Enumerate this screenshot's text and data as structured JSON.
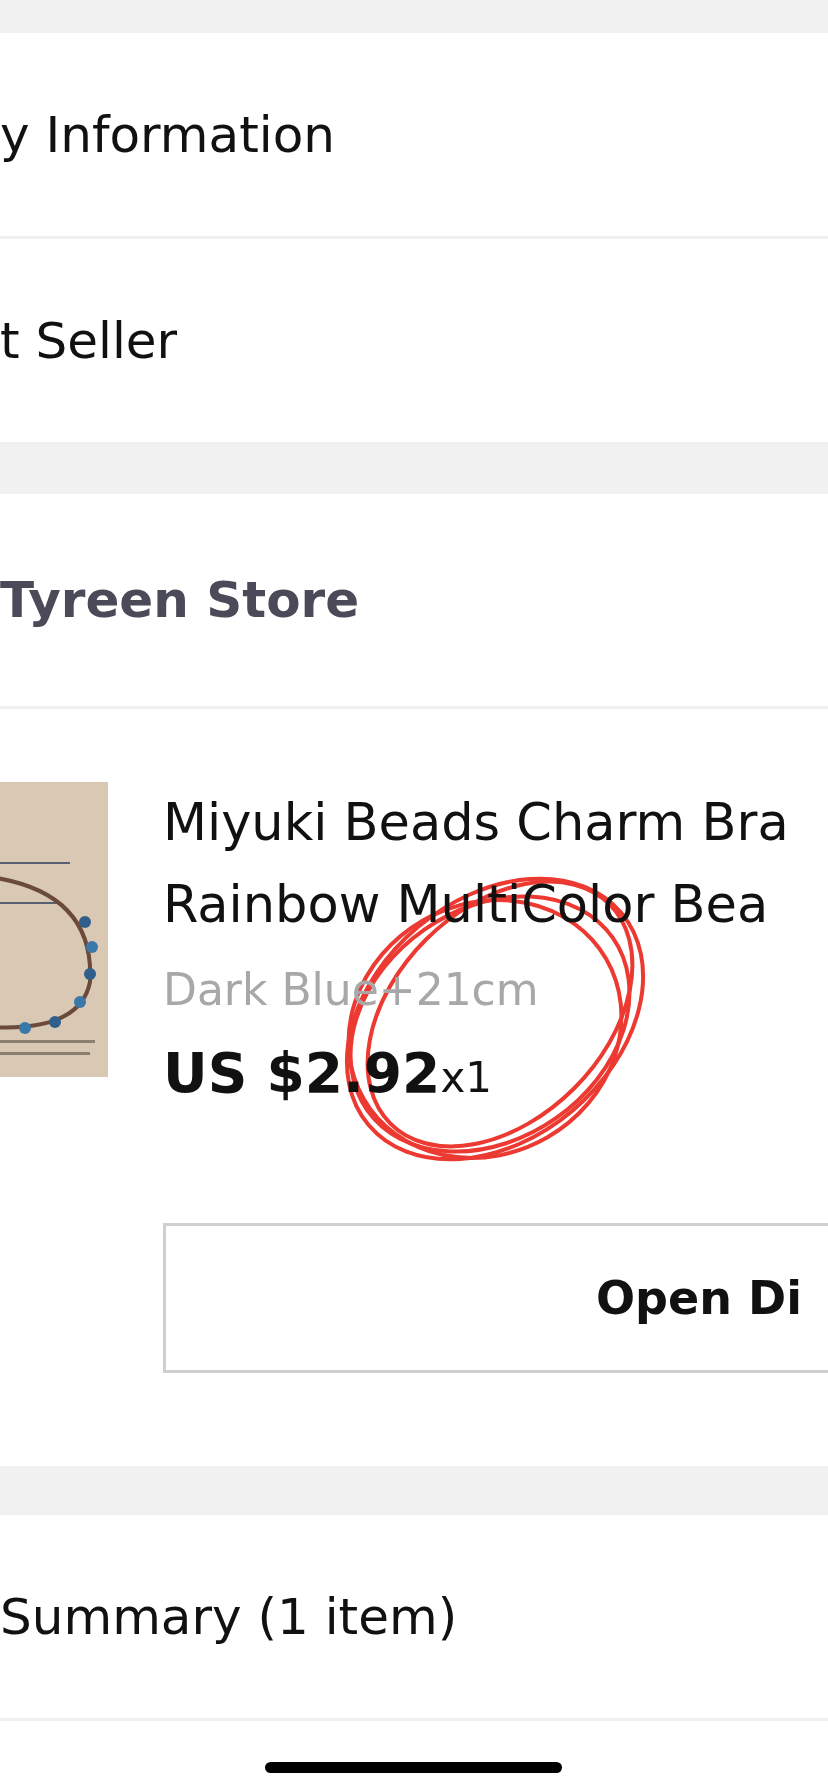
{
  "sections": [
    {
      "kind": "row",
      "label": "y Information"
    },
    {
      "kind": "row",
      "label": "t Seller"
    },
    {
      "kind": "gap"
    },
    {
      "kind": "store",
      "label": "Tyreen Store"
    },
    {
      "kind": "product",
      "title_lines": [
        "Miyuki Beads Charm Bra",
        "Rainbow MultiColor Bea"
      ],
      "variant": "Dark Blue+21cm",
      "price": "US $2.92",
      "quantity": "x1",
      "button": "Open Di"
    },
    {
      "kind": "gap"
    },
    {
      "kind": "row",
      "label": "Summary (1 item)"
    }
  ]
}
